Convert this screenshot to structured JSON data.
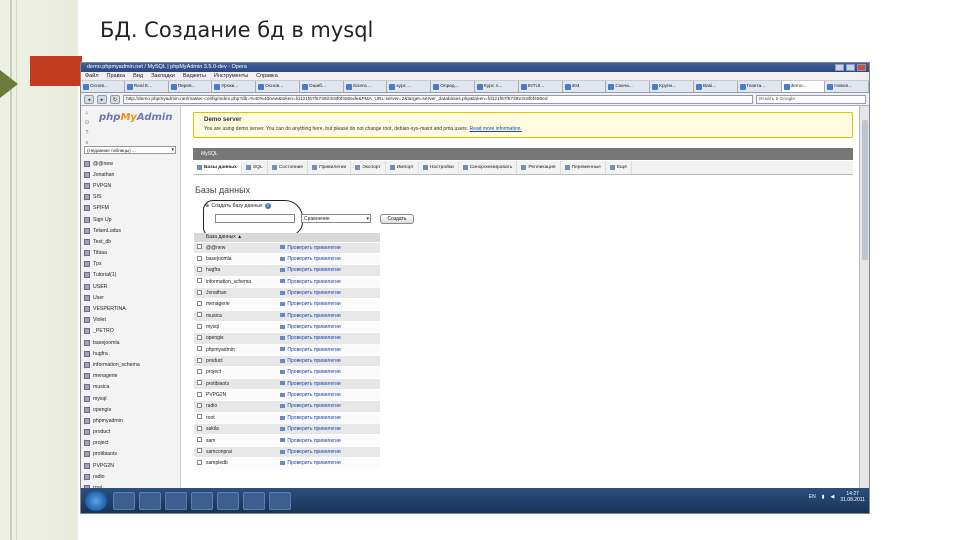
{
  "slide": {
    "title": "БД. Создание бд в mysql"
  },
  "browser": {
    "window_title": "demo.phpmyadmin.net / MySQL | phpMyAdmin 3.5.0-dev - Opera",
    "menu": [
      "Файл",
      "Правка",
      "Вид",
      "Закладки",
      "Виджеты",
      "Инструменты",
      "Справка"
    ],
    "tabs": [
      "Основ...",
      "Real E...",
      "Перев...",
      "Уроки...",
      "Основ...",
      "Ошиб...",
      "Scienc...",
      "курс ...",
      "Опред...",
      "Курс л...",
      "INTUI...",
      "404",
      "Скача...",
      "Крупн...",
      "Basi...",
      "Газета...",
      "demo...",
      "Новое..."
    ],
    "active_tab_index": 16,
    "address": "http://demo.phpmyadmin.net/master-config/index.php?db=%40%40new&token=fd121f67f574923c8f0f480ede&PMA_URL:server=2&target=server_databases.php&token=fd121f67f574923c8f0f480ed",
    "search_placeholder": "Искать в Google"
  },
  "pma": {
    "logo": {
      "php": "php",
      "my": "My",
      "admin": "Admin"
    },
    "db_select": "(Недавние таблицы) ...",
    "sidebar_dbs": [
      "@@new",
      "Jonathan",
      "PVPGN",
      "SIS",
      "SPIFM",
      "Sign Up",
      "TelamLudus",
      "Test_db",
      "Tibiaa",
      "Tps",
      "Tutorial(1)",
      "USER",
      "User",
      "VESPERTINA",
      "Violet",
      "_PETRO",
      "basejoomla",
      "hugfra",
      "information_schema",
      "menagerie",
      "musica",
      "mysql",
      "opengis",
      "phpmyadmin",
      "product",
      "project",
      "protibiaots",
      "PVPG2N",
      "radio",
      "root"
    ],
    "demo": {
      "title": "Demo server",
      "message": "You are using demo server. You can do anything here, but please do not change root, debian-sys-maint and pma users.",
      "link": "Read more information."
    },
    "server_bar": "MySQL",
    "tabs": [
      "Базы данных",
      "SQL",
      "Состояние",
      "Привилегии",
      "Экспорт",
      "Импорт",
      "Настройки",
      "Синхронизировать",
      "Репликация",
      "Переменные",
      "Ещё"
    ],
    "heading": "Базы данных",
    "create_label": "Создать базу данных",
    "collation": "Сравнение",
    "create_button": "Создать",
    "table": {
      "header": "База данных ▲",
      "priv_label": "Проверить привилегии",
      "rows": [
        "@@new",
        "basejoomla",
        "hugfra",
        "information_schema",
        "Jonathan",
        "menagerie",
        "musica",
        "mysql",
        "opengis",
        "phpmyadmin",
        "product",
        "project",
        "protibiaots",
        "PVPG2N",
        "radio",
        "root",
        "sakila",
        "sam",
        "samconprai",
        "sampledb"
      ]
    }
  },
  "taskbar": {
    "lang": "EN",
    "time": "14:27",
    "date": "31.08.2011"
  }
}
